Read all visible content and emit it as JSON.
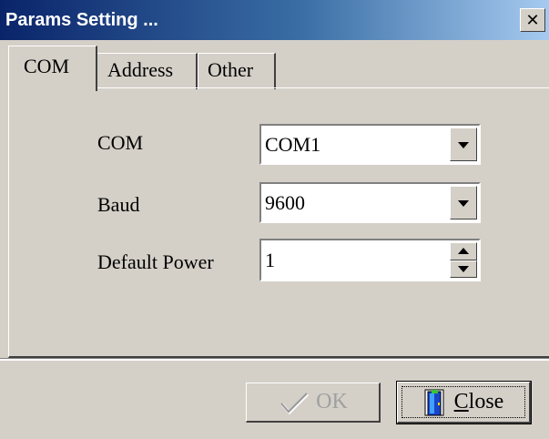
{
  "window": {
    "title": "Params Setting ...",
    "close_glyph": "✕"
  },
  "tabs": [
    {
      "label": "COM",
      "active": true
    },
    {
      "label": "Address",
      "active": false
    },
    {
      "label": "Other",
      "active": false
    }
  ],
  "form": {
    "com": {
      "label": "COM",
      "value": "COM1"
    },
    "baud": {
      "label": "Baud",
      "value": "9600"
    },
    "power": {
      "label": "Default Power",
      "value": "1"
    }
  },
  "buttons": {
    "ok": {
      "label": "OK",
      "enabled": false,
      "icon": "checkmark-icon"
    },
    "close": {
      "mnemonic": "C",
      "rest": "lose",
      "icon": "door-icon"
    }
  },
  "colors": {
    "title_start": "#0a246a",
    "title_end": "#a6caf0",
    "face": "#d4d0c8"
  }
}
